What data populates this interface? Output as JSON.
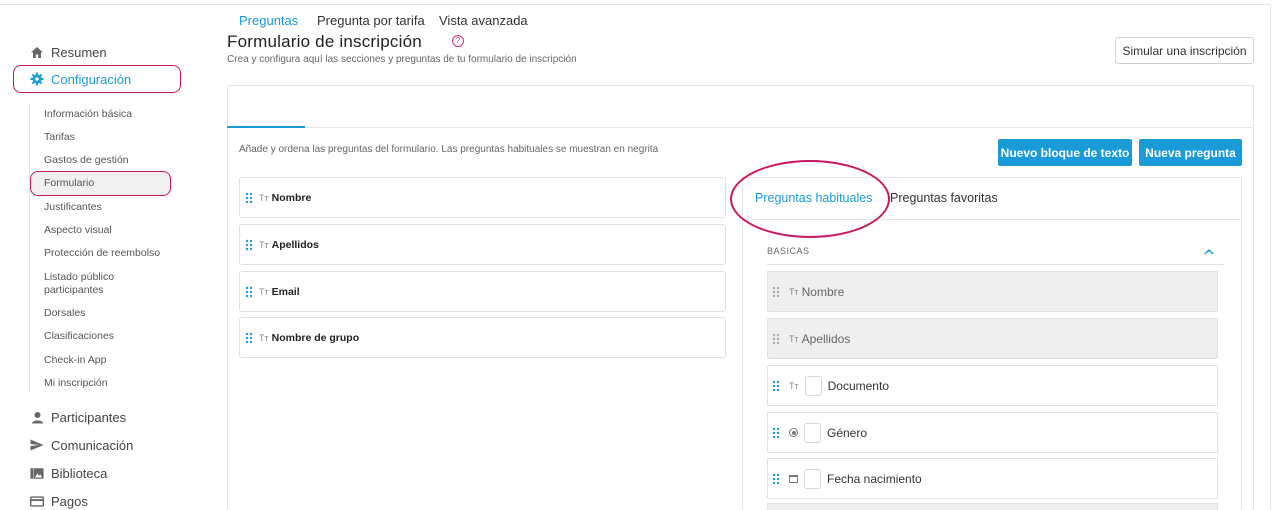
{
  "sidebar": {
    "main_top": [
      {
        "label": "Resumen",
        "icon": "home-icon"
      },
      {
        "label": "Configuración",
        "icon": "gear-icon",
        "active": true
      }
    ],
    "sub_items": [
      "Información básica",
      "Tarifas",
      "Gastos de gestión",
      "Formulario",
      "Justificantes",
      "Aspecto visual",
      "Protección de reembolso",
      "Listado público",
      "participantes",
      "Dorsales",
      "Clasificaciones",
      "Check-in App",
      "Mi inscripción"
    ],
    "main_bottom": [
      {
        "label": "Participantes",
        "icon": "person-icon"
      },
      {
        "label": "Comunicación",
        "icon": "send-icon"
      },
      {
        "label": "Biblioteca",
        "icon": "gallery-icon"
      },
      {
        "label": "Pagos",
        "icon": "card-icon"
      }
    ]
  },
  "header": {
    "title": "Formulario de inscripción",
    "help_icon": "?",
    "subtitle": "Crea y configura aquí las secciones y preguntas de tu formulario de inscripción",
    "simulate_button": "Simular una inscripción"
  },
  "tabs": [
    "Preguntas",
    "Pregunta por tarifa",
    "Vista avanzada"
  ],
  "main": {
    "hint": "Añade y ordena las preguntas del formulario. Las preguntas habituales se muestran en negrita",
    "new_text_block_button": "Nuevo bloque de texto",
    "new_question_button": "Nueva pregunta",
    "type_glyph": "Tт",
    "questions": [
      "Nombre",
      "Apellidos",
      "Email",
      "Nombre de grupo"
    ]
  },
  "right_panel": {
    "tabs": [
      "Preguntas habituales",
      "Preguntas favoritas"
    ],
    "section_title": "BASICAS",
    "items": [
      {
        "label": "Nombre",
        "type": "text",
        "disabled": true
      },
      {
        "label": "Apellidos",
        "type": "text",
        "disabled": true
      },
      {
        "label": "Documento",
        "type": "text",
        "disabled": false
      },
      {
        "label": "Género",
        "type": "radio",
        "disabled": false
      },
      {
        "label": "Fecha nacimiento",
        "type": "date",
        "disabled": false
      }
    ]
  },
  "colors": {
    "accent": "#1a9bd7",
    "highlight_ring": "#c8185e",
    "help_icon": "#d62f8c"
  }
}
